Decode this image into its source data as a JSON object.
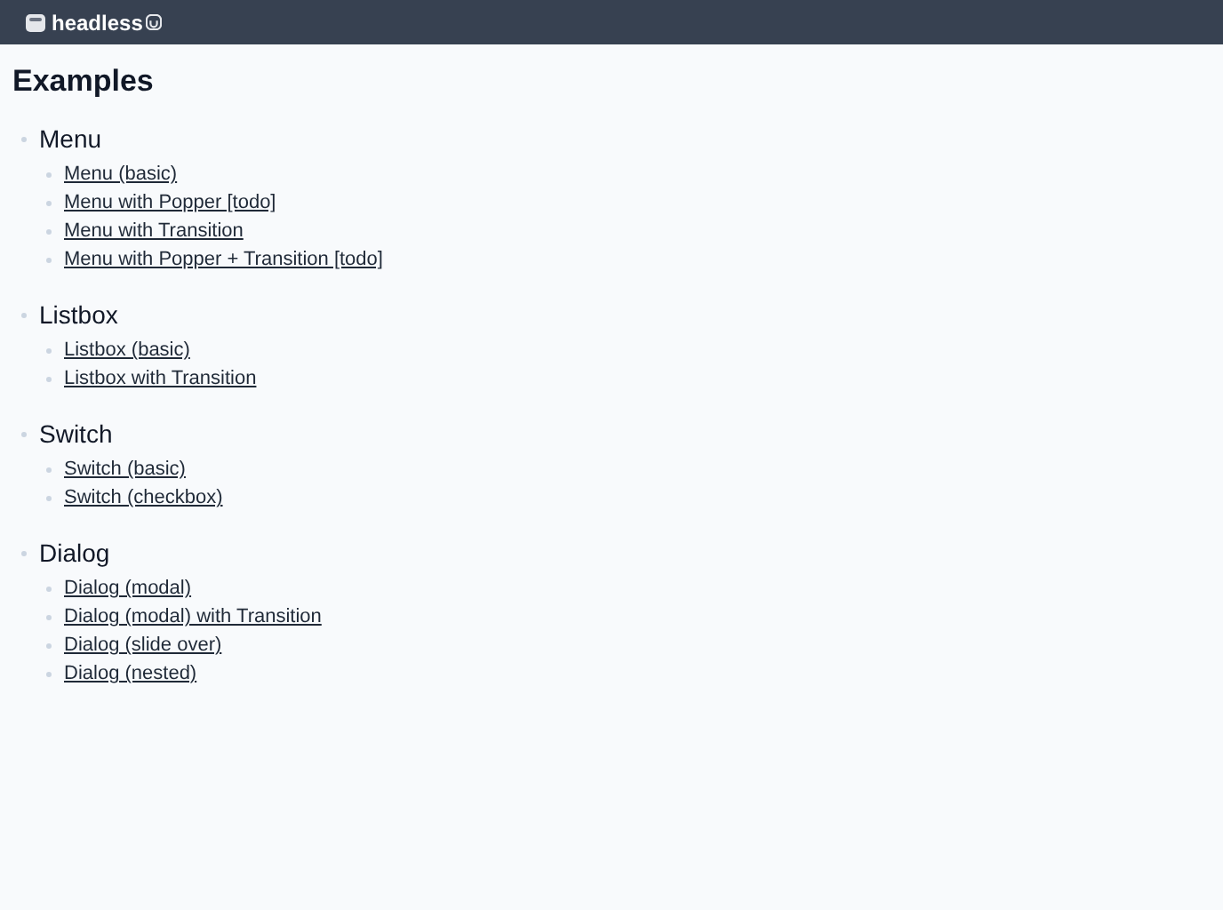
{
  "header": {
    "logo_text": "headless"
  },
  "title": "Examples",
  "sections": [
    {
      "heading": "Menu",
      "links": [
        "Menu (basic)",
        "Menu with Popper [todo]",
        "Menu with Transition",
        "Menu with Popper + Transition [todo]"
      ]
    },
    {
      "heading": "Listbox",
      "links": [
        "Listbox (basic)",
        "Listbox with Transition"
      ]
    },
    {
      "heading": "Switch",
      "links": [
        "Switch (basic)",
        "Switch (checkbox)"
      ]
    },
    {
      "heading": "Dialog",
      "links": [
        "Dialog (modal)",
        "Dialog (modal) with Transition",
        "Dialog (slide over)",
        "Dialog (nested)"
      ]
    }
  ]
}
